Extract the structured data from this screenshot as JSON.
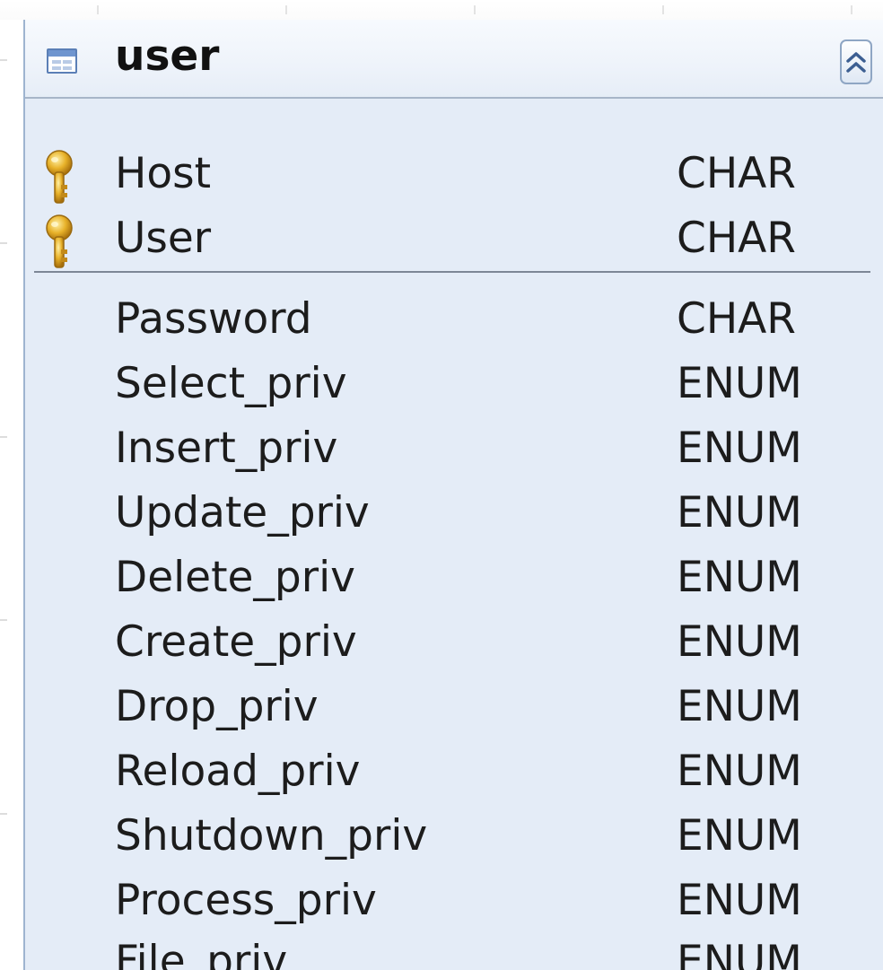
{
  "entity": {
    "title": "user",
    "icon": "table-icon",
    "collapse_icon": "double-chevron-up-icon",
    "primary_keys": [
      {
        "name": "Host",
        "type": "CHAR",
        "icon": "key-icon"
      },
      {
        "name": "User",
        "type": "CHAR",
        "icon": "key-icon"
      }
    ],
    "columns": [
      {
        "name": "Password",
        "type": "CHAR"
      },
      {
        "name": "Select_priv",
        "type": "ENUM"
      },
      {
        "name": "Insert_priv",
        "type": "ENUM"
      },
      {
        "name": "Update_priv",
        "type": "ENUM"
      },
      {
        "name": "Delete_priv",
        "type": "ENUM"
      },
      {
        "name": "Create_priv",
        "type": "ENUM"
      },
      {
        "name": "Drop_priv",
        "type": "ENUM"
      },
      {
        "name": "Reload_priv",
        "type": "ENUM"
      },
      {
        "name": "Shutdown_priv",
        "type": "ENUM"
      },
      {
        "name": "Process_priv",
        "type": "ENUM"
      },
      {
        "name": "File_priv",
        "type": "ENUM"
      }
    ]
  },
  "colors": {
    "body_background": "#e4ecf7",
    "header_background": "#eef3fa",
    "border": "#a7b5c8",
    "key_gold": "#e0a81c"
  }
}
